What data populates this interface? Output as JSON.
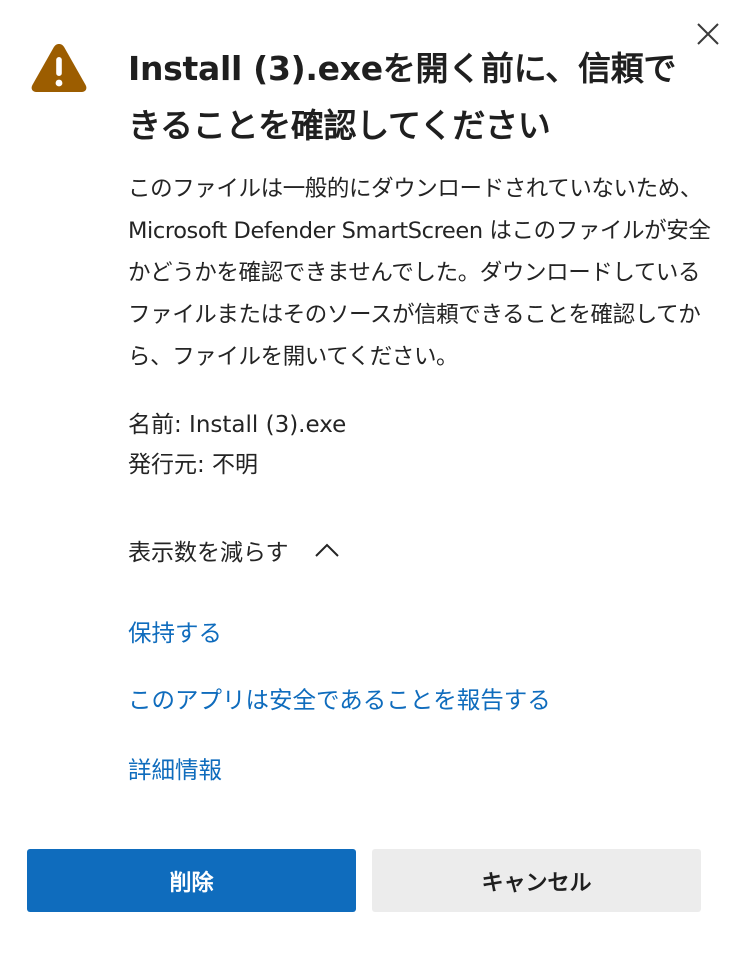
{
  "dialog": {
    "title": "Install (3).exeを開く前に、信頼できることを確認してください",
    "body": "このファイルは一般的にダウンロードされていないため、Microsoft Defender SmartScreen はこのファイルが安全かどうかを確認できませんでした。ダウンロードしているファイルまたはそのソースが信頼できることを確認してから、ファイルを開いてください。",
    "file_name": "名前: Install (3).exe",
    "publisher": "発行元: 不明",
    "toggle_label": "表示数を減らす",
    "links": {
      "keep": "保持する",
      "report_safe": "このアプリは安全であることを報告する",
      "more_info": "詳細情報"
    },
    "buttons": {
      "delete": "削除",
      "cancel": "キャンセル"
    },
    "icons": {
      "warning": "warning-icon",
      "close": "close-icon",
      "chevron": "chevron-up-icon"
    },
    "colors": {
      "accent": "#0f6cbd",
      "warning": "#9c5d00",
      "secondary_button": "#ececec"
    }
  }
}
